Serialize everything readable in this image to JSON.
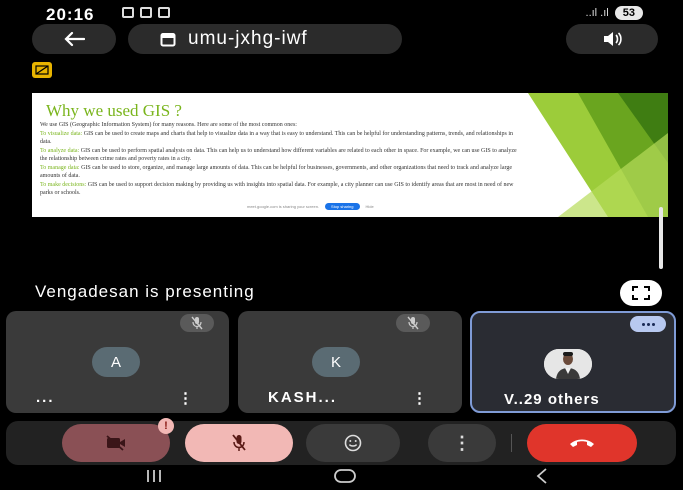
{
  "status_bar": {
    "time": "20:16",
    "signal": "..ıl .ıl",
    "battery": "53"
  },
  "header": {
    "meeting_code": "umu-jxhg-iwf"
  },
  "slide": {
    "title": "Why we used GIS ?",
    "intro": "We use GIS (Geographic Information System) for many reasons. Here are some of the most common ones:",
    "points": [
      {
        "head": "To visualize data:",
        "text": "GIS can be used to create maps and charts that help to visualize data in a way that is easy to understand. This can be helpful for understanding patterns, trends, and relationships in data."
      },
      {
        "head": "To analyze data:",
        "text": "GIS can be used to perform spatial analysis on data. This can help us to understand how different variables are related to each other in space. For example, we can use GIS to analyze the relationship between crime rates and poverty rates in a city."
      },
      {
        "head": "To manage data:",
        "text": "GIS can be used to store, organize, and manage large amounts of data. This can be helpful for businesses, governments, and other organizations that need to track and analyze large amounts of data."
      },
      {
        "head": "To make decisions:",
        "text": "GIS can be used to support decision making by providing us with insights into spatial data. For example, a city planner can use GIS to identify areas that are most in need of new parks or schools."
      }
    ],
    "share_notice": "meet.google.com is sharing your screen.",
    "share_stop": "Stop sharing",
    "share_hide": "Hide"
  },
  "presenting_text": "Vengadesan is presenting",
  "participants": [
    {
      "avatar_letter": "A",
      "name": "..."
    },
    {
      "avatar_letter": "K",
      "name": "KASH..."
    },
    {
      "name": "V..29 others"
    }
  ],
  "controls": {
    "camera_alert": "!"
  },
  "colors": {
    "background": "#000000",
    "tile": "#3a3a3a",
    "leave": "#e0352b",
    "mic_off": "#f2b8b5",
    "cam_off": "#8a5055",
    "slide_accent": "#7ab51d"
  }
}
